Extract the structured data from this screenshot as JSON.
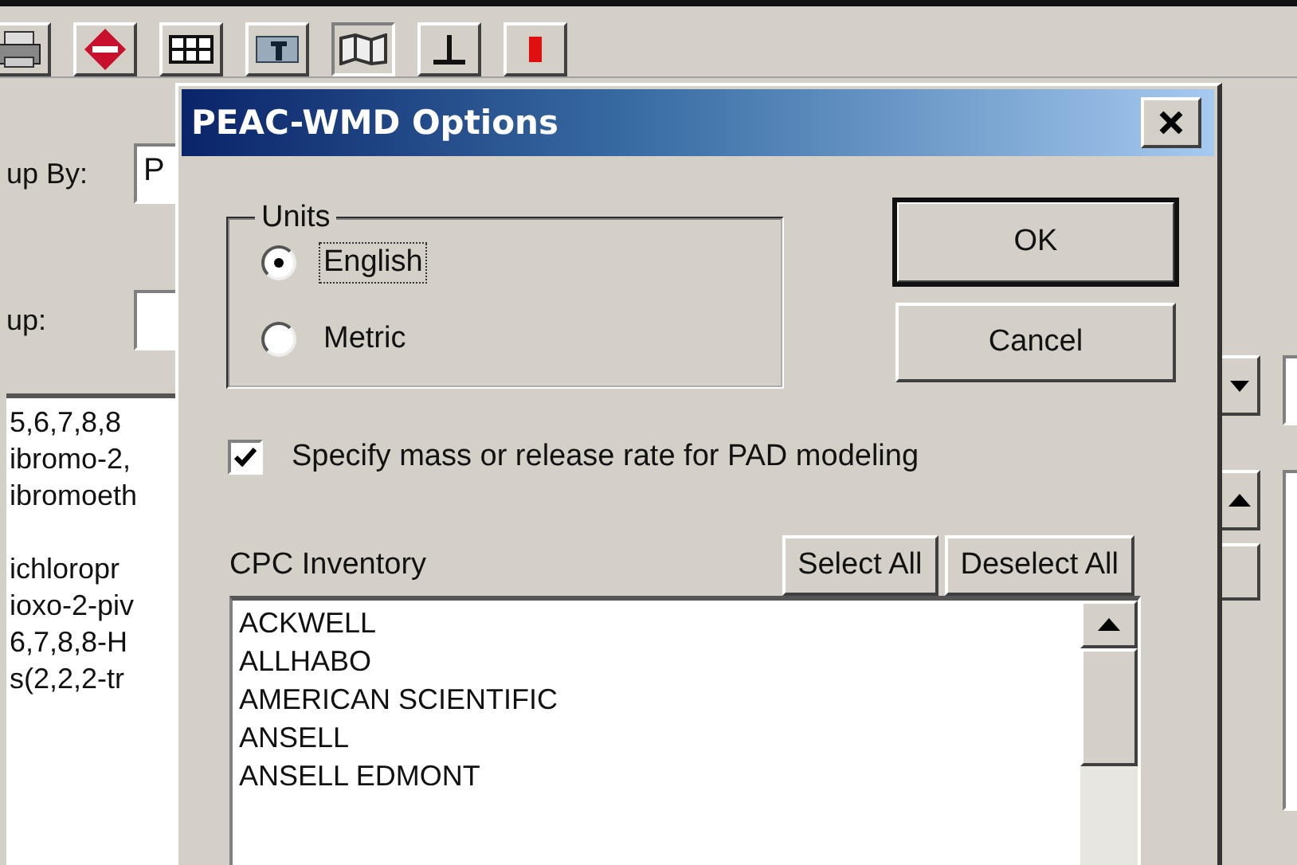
{
  "toolbar": [
    {
      "pressed": false
    },
    {
      "pressed": false
    },
    {
      "pressed": false
    },
    {
      "pressed": false
    },
    {
      "pressed": true
    },
    {
      "pressed": false
    },
    {
      "pressed": false
    }
  ],
  "left_panel": {
    "group_by": {
      "label": "up By:",
      "value": "P"
    },
    "group": {
      "label": "up:"
    },
    "list_groups": [
      [
        "5,6,7,8,8",
        "ibromo-2,",
        "ibromoeth"
      ],
      [
        "ichloropr",
        "ioxo-2-piv",
        "6,7,8,8-H",
        "s(2,2,2-tr"
      ]
    ]
  },
  "dialog": {
    "title": "PEAC-WMD Options",
    "units": {
      "legend": "Units",
      "options": [
        {
          "label": "English",
          "selected": true,
          "focused": true
        },
        {
          "label": "Metric",
          "selected": false,
          "focused": false
        }
      ]
    },
    "buttons": [
      {
        "label": "OK",
        "default": true
      },
      {
        "label": "Cancel",
        "default": false
      }
    ],
    "pad_option": {
      "label": "Specify mass or release rate for PAD modeling",
      "checked": true
    },
    "inventory": {
      "label": "CPC Inventory",
      "select_all": "Select All",
      "deselect_all": "Deselect All",
      "items": [
        "ACKWELL",
        "ALLHABO",
        "AMERICAN SCIENTIFIC",
        "ANSELL",
        "ANSELL EDMONT"
      ]
    }
  }
}
